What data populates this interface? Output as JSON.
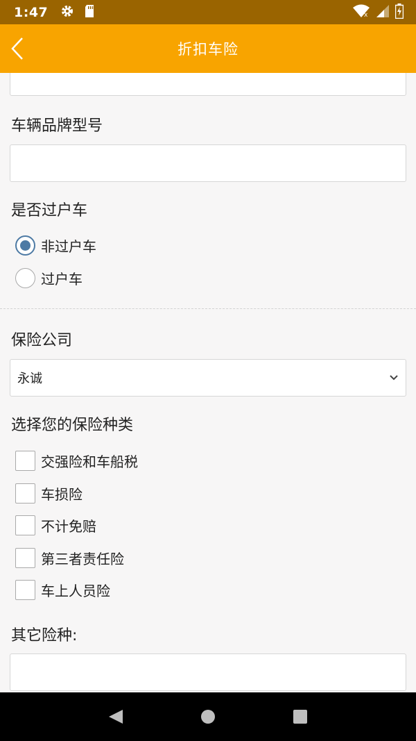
{
  "status_bar": {
    "time": "1:47",
    "icons": [
      "gear-icon",
      "sd-card-icon",
      "wifi-icon",
      "signal-icon",
      "battery-charging-icon"
    ],
    "color": "#9a6400"
  },
  "header": {
    "title": "折扣车险",
    "back_icon": "chevron-left-icon",
    "color": "#f8a400"
  },
  "form": {
    "top_input": {
      "value": "",
      "placeholder": ""
    },
    "brand_model": {
      "label": "车辆品牌型号",
      "value": "",
      "placeholder": ""
    },
    "transfer": {
      "label": "是否过户车",
      "options": [
        {
          "label": "非过户车",
          "checked": true
        },
        {
          "label": "过户车",
          "checked": false
        }
      ]
    },
    "company": {
      "label": "保险公司",
      "selected": "永诚"
    },
    "insurance_types": {
      "label": "选择您的保险种类",
      "options": [
        {
          "label": "交强险和车船税",
          "checked": false
        },
        {
          "label": "车损险",
          "checked": false
        },
        {
          "label": "不计免赔",
          "checked": false
        },
        {
          "label": "第三者责任险",
          "checked": false
        },
        {
          "label": "车上人员险",
          "checked": false
        }
      ]
    },
    "other": {
      "label": "其它险种:",
      "value": "",
      "placeholder": ""
    }
  },
  "nav_bar": {
    "buttons": [
      "back-triangle-icon",
      "home-circle-icon",
      "recents-square-icon"
    ]
  }
}
